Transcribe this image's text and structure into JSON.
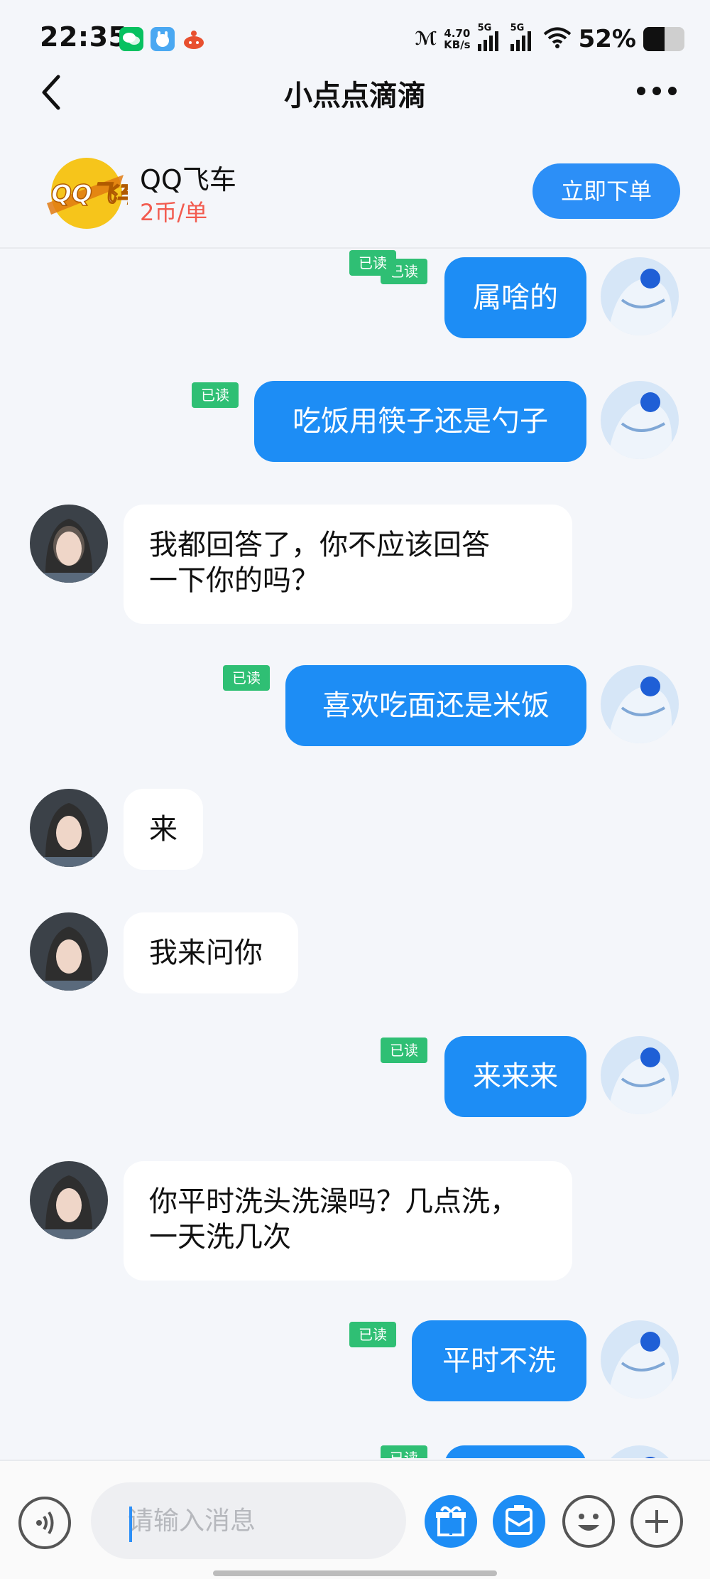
{
  "status_bar": {
    "time": "22:35",
    "net_speed_value": "4.70",
    "net_speed_unit": "KB/s",
    "signal_1_label": "5G",
    "signal_2_label": "5G",
    "battery_percent": "52%",
    "battery_level": 0.52,
    "apps": [
      "wechat-icon",
      "app-icon",
      "notification-icon"
    ]
  },
  "nav": {
    "title": "小点点滴滴"
  },
  "product": {
    "name": "QQ飞车",
    "price": "2币/单",
    "order_button": "立即下单",
    "logo_text": "QQ飞车"
  },
  "chat": {
    "read_label": "已读",
    "messages": [
      {
        "from": "me",
        "text": "属啥的",
        "read": true
      },
      {
        "from": "me",
        "text": "吃饭用筷子还是勺子",
        "read": true
      },
      {
        "from": "other",
        "lines": [
          "我都回答了，你不应该回答",
          "一下你的吗？"
        ]
      },
      {
        "from": "me",
        "text": "喜欢吃面还是米饭",
        "read": true
      },
      {
        "from": "other",
        "text": "来"
      },
      {
        "from": "other",
        "text": "我来问你"
      },
      {
        "from": "me",
        "text": "来来来",
        "read": true
      },
      {
        "from": "other",
        "lines": [
          "你平时洗头洗澡吗？几点洗，",
          "一天洗几次"
        ]
      },
      {
        "from": "me",
        "text": "平时不洗",
        "read": true
      }
    ]
  },
  "input": {
    "placeholder": "请输入消息"
  },
  "colors": {
    "accent": "#1d8df5",
    "read_badge": "#2fbf74",
    "price": "#f25b4f",
    "background": "#f4f6fa"
  }
}
